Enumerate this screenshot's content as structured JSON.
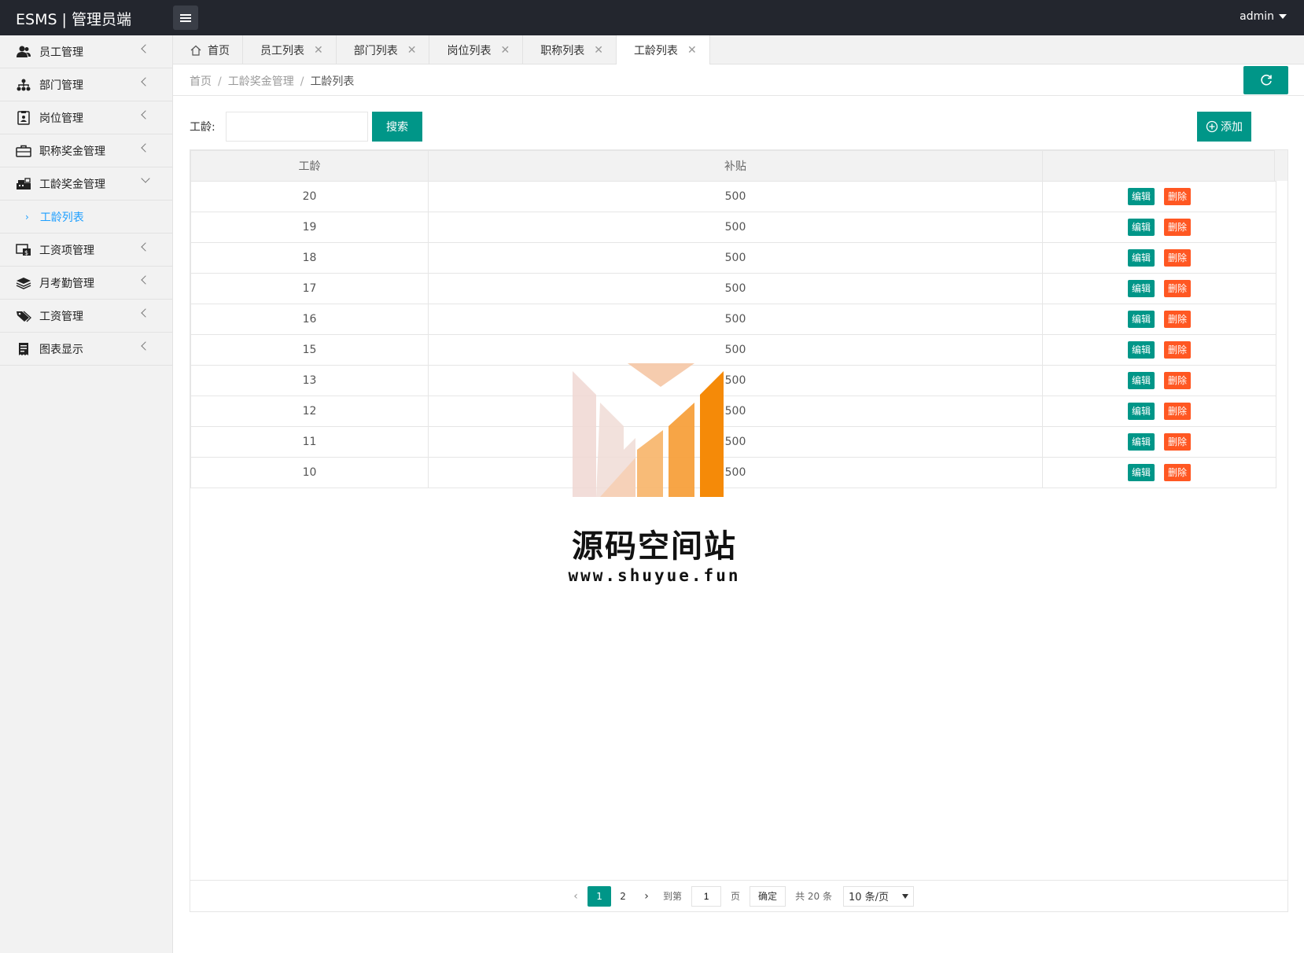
{
  "header": {
    "title": "ESMS | 管理员端",
    "user": "admin"
  },
  "sidebar": {
    "items": [
      {
        "label": "员工管理",
        "icon": "users-icon"
      },
      {
        "label": "部门管理",
        "icon": "sitemap-icon"
      },
      {
        "label": "岗位管理",
        "icon": "id-card-icon"
      },
      {
        "label": "职称奖金管理",
        "icon": "briefcase-icon"
      },
      {
        "label": "工龄奖金管理",
        "icon": "cash-register-icon"
      },
      {
        "label": "工资项管理",
        "icon": "money-screen-icon"
      },
      {
        "label": "月考勤管理",
        "icon": "layers-icon"
      },
      {
        "label": "工资管理",
        "icon": "tag-icon"
      },
      {
        "label": "图表显示",
        "icon": "receipt-icon"
      }
    ],
    "sub_items": [
      {
        "label": "工龄列表"
      }
    ]
  },
  "tabs": [
    {
      "label": "首页"
    },
    {
      "label": "员工列表"
    },
    {
      "label": "部门列表"
    },
    {
      "label": "岗位列表"
    },
    {
      "label": "职称列表"
    },
    {
      "label": "工龄列表"
    }
  ],
  "breadcrumb": [
    "首页",
    "工龄奖金管理",
    "工龄列表"
  ],
  "toolbar": {
    "search_label": "工龄:",
    "search_value": "",
    "search_button": "搜索",
    "add_button": "添加"
  },
  "table": {
    "columns": [
      "工龄",
      "补贴",
      ""
    ],
    "rows": [
      {
        "years": "20",
        "subsidy": "500"
      },
      {
        "years": "19",
        "subsidy": "500"
      },
      {
        "years": "18",
        "subsidy": "500"
      },
      {
        "years": "17",
        "subsidy": "500"
      },
      {
        "years": "16",
        "subsidy": "500"
      },
      {
        "years": "15",
        "subsidy": "500"
      },
      {
        "years": "13",
        "subsidy": "500"
      },
      {
        "years": "12",
        "subsidy": "500"
      },
      {
        "years": "11",
        "subsidy": "500"
      },
      {
        "years": "10",
        "subsidy": "500"
      }
    ],
    "edit_label": "编辑",
    "delete_label": "删除"
  },
  "pagination": {
    "pages": [
      "1",
      "2"
    ],
    "current": "1",
    "goto_prefix": "到第",
    "goto_value": "1",
    "goto_suffix": "页",
    "confirm": "确定",
    "total": "共 20 条",
    "page_size": "10 条/页"
  },
  "watermark": {
    "title": "源码空间站",
    "url": "www.shuyue.fun"
  },
  "colors": {
    "primary": "#009688",
    "danger": "#ff5722",
    "header_bg": "#23262e",
    "link": "#1e9fff"
  }
}
